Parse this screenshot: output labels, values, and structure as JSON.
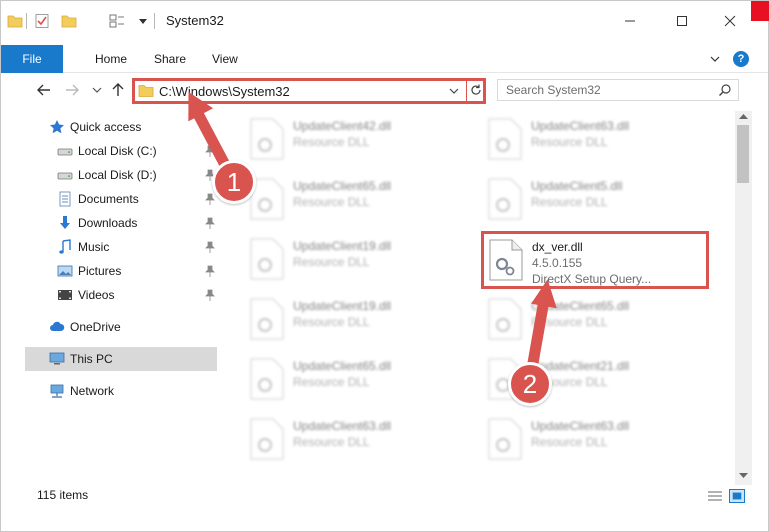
{
  "window": {
    "title": "System32"
  },
  "ribbon": {
    "tabs": [
      "File",
      "Home",
      "Share",
      "View"
    ],
    "help_label": "?"
  },
  "navbar": {
    "address": "C:\\Windows\\System32",
    "search_placeholder": "Search System32"
  },
  "sidebar": {
    "items": [
      {
        "label": "Quick access",
        "icon": "star-icon"
      },
      {
        "label": "Local Disk (C:)",
        "icon": "drive-icon",
        "pinned": true
      },
      {
        "label": "Local Disk (D:)",
        "icon": "drive-icon",
        "pinned": true
      },
      {
        "label": "Documents",
        "icon": "documents-icon",
        "pinned": true
      },
      {
        "label": "Downloads",
        "icon": "downloads-icon",
        "pinned": true
      },
      {
        "label": "Music",
        "icon": "music-icon",
        "pinned": true
      },
      {
        "label": "Pictures",
        "icon": "pictures-icon",
        "pinned": true
      },
      {
        "label": "Videos",
        "icon": "videos-icon",
        "pinned": true
      },
      {
        "label": "OneDrive",
        "icon": "cloud-icon"
      },
      {
        "label": "This PC",
        "icon": "computer-icon",
        "selected": true
      },
      {
        "label": "Network",
        "icon": "network-icon"
      }
    ]
  },
  "files": [
    {
      "name": "UpdateClient42.dll",
      "type": "Resource DLL"
    },
    {
      "name": "UpdateClient63.dll",
      "type": "Resource DLL"
    },
    {
      "name": "UpdateClient65.dll",
      "type": "Resource DLL"
    },
    {
      "name": "UpdateClient5.dll",
      "type": "Resource DLL"
    },
    {
      "name": "UpdateClient19.dll",
      "type": "Resource DLL"
    },
    {
      "name": "dx_ver.dll",
      "type": "4.5.0.155",
      "description": "DirectX Setup Query..."
    },
    {
      "name": "UpdateClient19.dll",
      "type": "Resource DLL"
    },
    {
      "name": "UpdateClient65.dll",
      "type": "Resource DLL"
    },
    {
      "name": "UpdateClient65.dll",
      "type": "Resource DLL"
    },
    {
      "name": "UpdateClient21.dll",
      "type": "Resource DLL"
    },
    {
      "name": "UpdateClient63.dll",
      "type": "Resource DLL"
    },
    {
      "name": "UpdateClient63.dll",
      "type": "Resource DLL"
    }
  ],
  "status": {
    "count": "115 items"
  },
  "annotations": {
    "step1": "1",
    "step2": "2",
    "color": "#d9534f"
  },
  "colors": {
    "accent": "#1979ca",
    "highlight": "#d9534f"
  }
}
